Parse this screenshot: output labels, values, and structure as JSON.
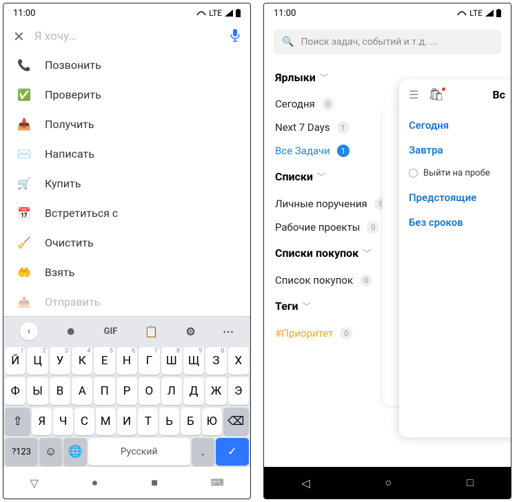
{
  "left": {
    "status_time": "11:00",
    "status_net": "LTE",
    "input_placeholder": "Я хочу…",
    "suggestions": [
      {
        "icon": "📞",
        "label": "Позвонить"
      },
      {
        "icon": "✅",
        "label": "Проверить"
      },
      {
        "icon": "📥",
        "label": "Получить"
      },
      {
        "icon": "✉️",
        "label": "Написать"
      },
      {
        "icon": "🛒",
        "label": "Купить"
      },
      {
        "icon": "📅",
        "label": "Встретиться с"
      },
      {
        "icon": "🧹",
        "label": "Очистить"
      },
      {
        "icon": "✋",
        "label": "Взять"
      },
      {
        "icon": "📤",
        "label": "Отправить"
      }
    ],
    "kbd_toolbar_gif": "GIF",
    "kbd_row1": [
      "Й",
      "Ц",
      "У",
      "К",
      "Е",
      "Н",
      "Г",
      "Ш",
      "Щ",
      "З",
      "Х"
    ],
    "kbd_row1_sup": [
      "1",
      "2",
      "3",
      "4",
      "5",
      "6",
      "7",
      "8",
      "9",
      "0",
      ""
    ],
    "kbd_row2": [
      "Ф",
      "Ы",
      "В",
      "А",
      "П",
      "Р",
      "О",
      "Л",
      "Д",
      "Ж",
      "Э"
    ],
    "kbd_row3": [
      "Я",
      "Ч",
      "С",
      "М",
      "И",
      "Т",
      "Ь",
      "Б",
      "Ю"
    ],
    "kbd_numlabel": "?123",
    "kbd_space": "Русский"
  },
  "right": {
    "status_time": "11:00",
    "status_net": "LTE",
    "search_placeholder": "Поиск задач, событий и т.д. ...",
    "sect_labels": "Ярлыки",
    "sect_lists": "Списки",
    "sect_shop": "Списки покупок",
    "sect_tags": "Теги",
    "labels": [
      {
        "name": "Сегодня",
        "count": "0"
      },
      {
        "name": "Next 7 Days",
        "count": "1"
      },
      {
        "name": "Все Задачи",
        "count": "1",
        "active": true
      }
    ],
    "lists": [
      {
        "name": "Личные поручения",
        "count": "1"
      },
      {
        "name": "Рабочие проекты",
        "count": "0"
      }
    ],
    "shop": [
      {
        "name": "Список покупок",
        "count": "0"
      }
    ],
    "tags": [
      {
        "name": "#Приоритет",
        "count": "0"
      }
    ],
    "overlay": {
      "title_cut": "Вс",
      "links1": "Сегодня",
      "links2": "Завтра",
      "task": "Выйти на пробе",
      "links3": "Предстоящие",
      "links4": "Без сроков"
    }
  }
}
